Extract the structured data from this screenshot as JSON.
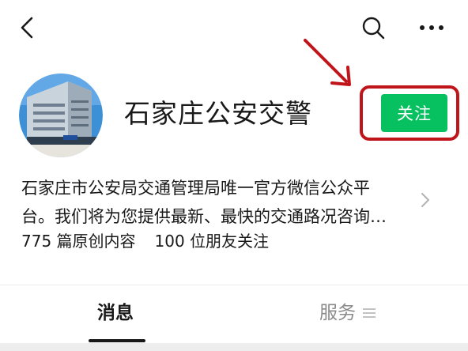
{
  "nav": {
    "back_icon": "chevron-left-icon",
    "search_icon": "search-icon",
    "more_icon": "more-horizontal-icon"
  },
  "profile": {
    "name": "石家庄公安交警",
    "follow_label": "关注",
    "description_line1": "石家庄市公安局交通管理局唯一官方微信公众平",
    "description_line2": "台。我们将为您提供最新、最快的交通路况咨询…",
    "original_content_count": "775 篇原创内容",
    "friends_following": "100 位朋友关注"
  },
  "tabs": [
    {
      "label": "消息",
      "active": true
    },
    {
      "label": "服务",
      "active": false
    }
  ],
  "colors": {
    "accent_green": "#07c160",
    "annotation_red": "#c0141b",
    "text_primary": "#191919",
    "text_secondary": "#8a8a8a"
  }
}
